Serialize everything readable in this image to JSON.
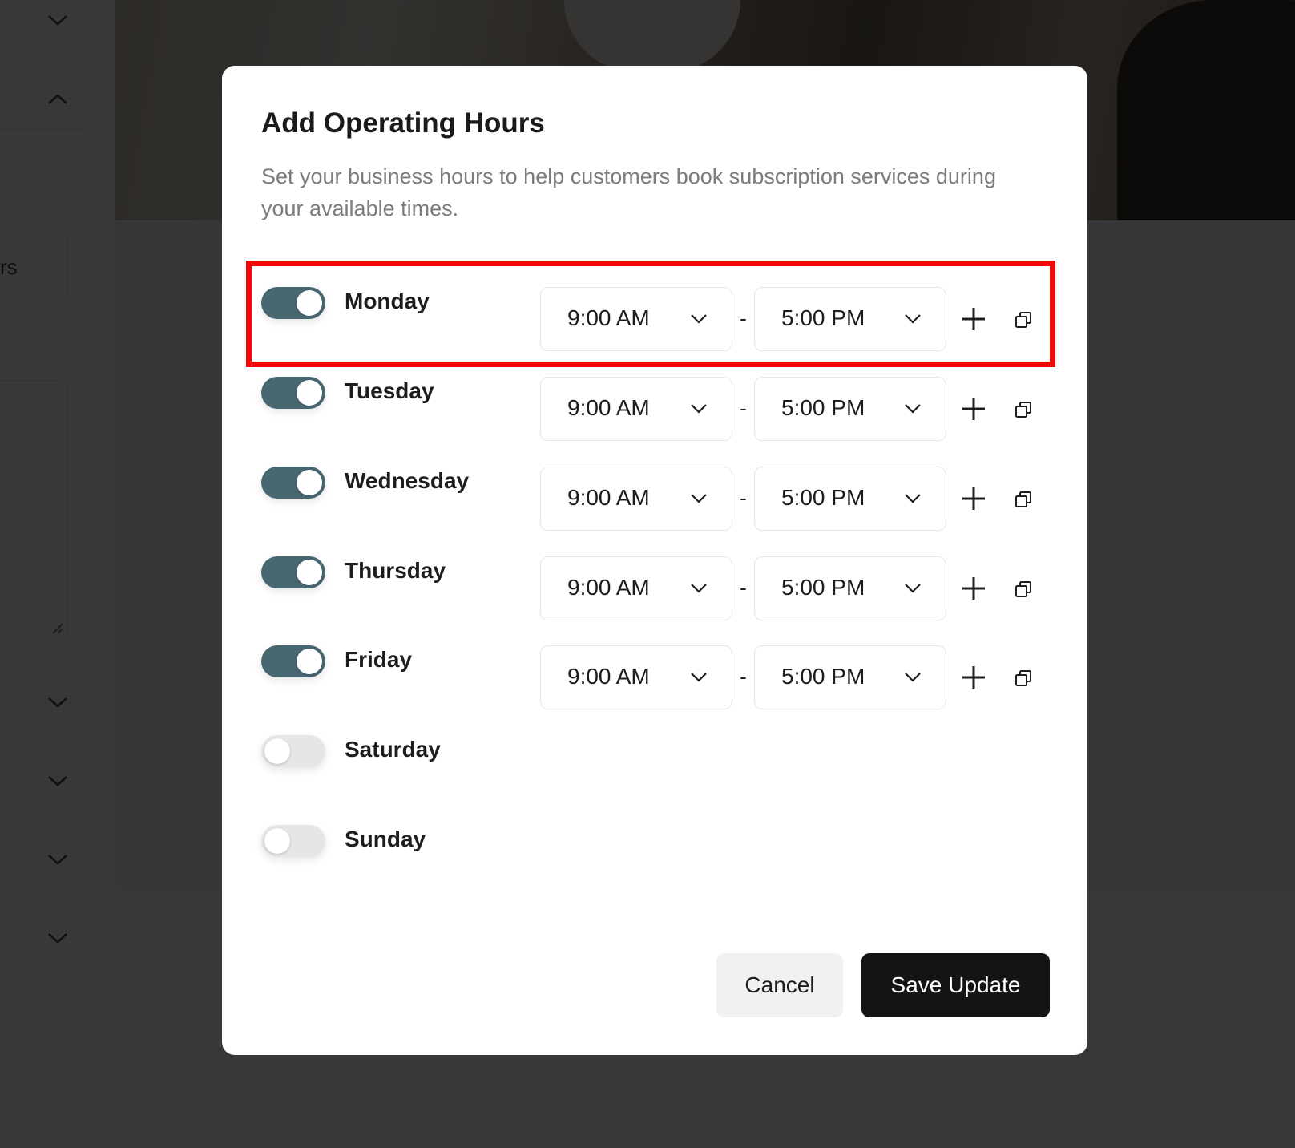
{
  "background": {
    "field_partial_text": "rs"
  },
  "modal": {
    "title": "Add Operating Hours",
    "description": "Set your business hours to help customers book subscription services during your available times.",
    "days": [
      {
        "label": "Monday",
        "enabled": true,
        "start": "9:00 AM",
        "end": "5:00 PM"
      },
      {
        "label": "Tuesday",
        "enabled": true,
        "start": "9:00 AM",
        "end": "5:00 PM"
      },
      {
        "label": "Wednesday",
        "enabled": true,
        "start": "9:00 AM",
        "end": "5:00 PM"
      },
      {
        "label": "Thursday",
        "enabled": true,
        "start": "9:00 AM",
        "end": "5:00 PM"
      },
      {
        "label": "Friday",
        "enabled": true,
        "start": "9:00 AM",
        "end": "5:00 PM"
      },
      {
        "label": "Saturday",
        "enabled": false
      },
      {
        "label": "Sunday",
        "enabled": false
      }
    ],
    "separator": "-",
    "cancel_label": "Cancel",
    "save_label": "Save Update"
  },
  "colors": {
    "toggle_on": "#496771",
    "toggle_off": "#e6e6e6",
    "primary_button": "#141414",
    "highlight": "#f20808"
  },
  "icons": [
    "chevron-down-icon",
    "chevron-up-icon",
    "plus-icon",
    "copy-icon",
    "resize-handle-icon"
  ]
}
